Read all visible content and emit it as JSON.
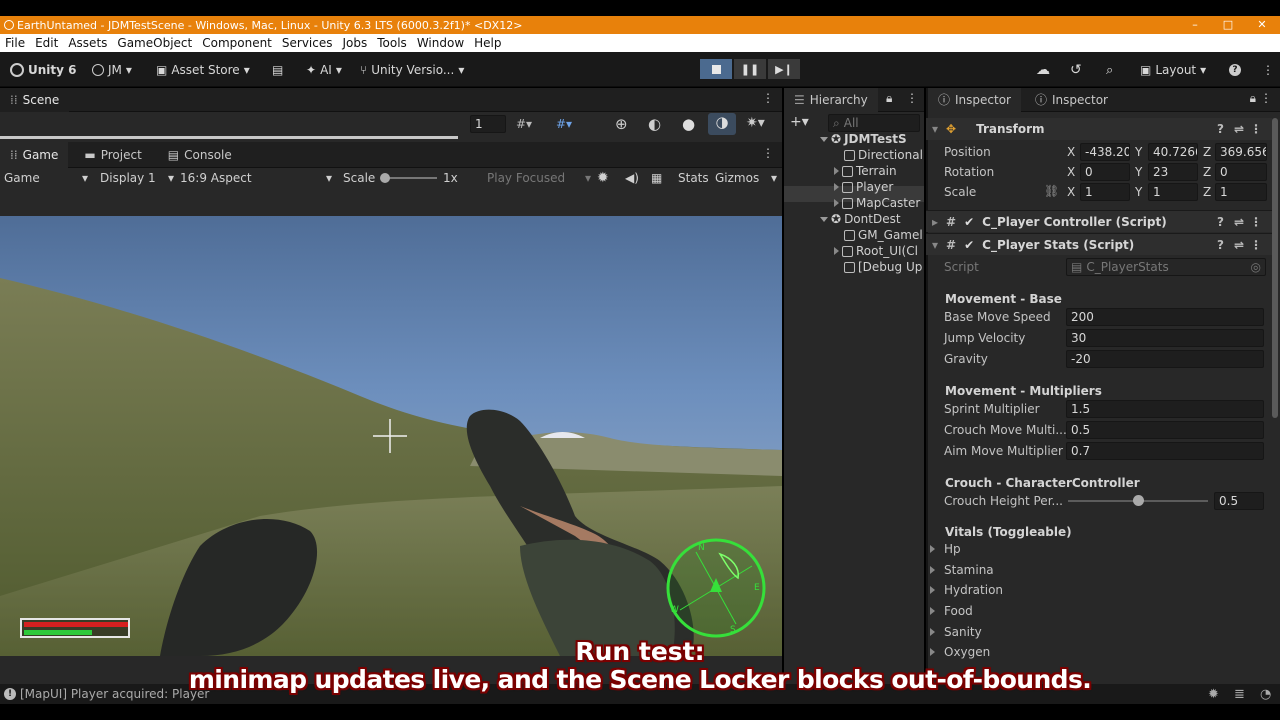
{
  "window": {
    "title": "EarthUntamed - JDMTestScene - Windows, Mac, Linux - Unity 6.3 LTS (6000.3.2f1)* <DX12>",
    "controls": [
      "–",
      "□",
      "✕"
    ]
  },
  "menu": [
    "File",
    "Edit",
    "Assets",
    "GameObject",
    "Component",
    "Services",
    "Jobs",
    "Tools",
    "Window",
    "Help"
  ],
  "toolbar": {
    "unity_label": "Unity 6",
    "account": "JM",
    "asset_store": "Asset Store",
    "ai": "AI",
    "version_control": "Unity Versio...",
    "layout": "Layout"
  },
  "scene": {
    "tab": "Scene",
    "field_value": "1"
  },
  "game": {
    "tabs": [
      "Game",
      "Project",
      "Console"
    ],
    "view_select": "Game",
    "display_select": "Display 1",
    "aspect_select": "16:9 Aspect",
    "scale_label": "Scale",
    "scale_value": "1x",
    "play_focused": "Play Focused",
    "stats": "Stats",
    "gizmos": "Gizmos",
    "hud": {
      "health_fraction": 1.0,
      "stamina_fraction": 0.65,
      "health_color": "#d62020",
      "stamina_color": "#2ec93a",
      "compass_letters": [
        "N",
        "E",
        "S",
        "W"
      ],
      "compass_color": "#36e03a"
    }
  },
  "hierarchy": {
    "tab": "Hierarchy",
    "search_placeholder": "All",
    "items": [
      {
        "label": "JDMTestS",
        "kind": "scene"
      },
      {
        "label": "Directional",
        "kind": "object"
      },
      {
        "label": "Terrain",
        "kind": "object"
      },
      {
        "label": "Player",
        "kind": "object",
        "selected": true
      },
      {
        "label": "MapCaster",
        "kind": "object"
      },
      {
        "label": "DontDest",
        "kind": "scene"
      },
      {
        "label": "GM_Gamel",
        "kind": "object"
      },
      {
        "label": "Root_UI(Cl",
        "kind": "object"
      },
      {
        "label": "[Debug Up",
        "kind": "object"
      }
    ]
  },
  "inspector": {
    "tabs": [
      "Inspector",
      "Inspector"
    ],
    "transform": {
      "title": "Transform",
      "position_label": "Position",
      "rotation_label": "Rotation",
      "scale_label": "Scale",
      "position": {
        "x": "-438.20",
        "y": "40.7266",
        "z": "369.656"
      },
      "rotation": {
        "x": "0",
        "y": "23",
        "z": "0"
      },
      "scale": {
        "x": "1",
        "y": "1",
        "z": "1"
      },
      "axis_labels": [
        "X",
        "Y",
        "Z"
      ]
    },
    "components": [
      "C_Player Controller (Script)",
      "C_Player Stats (Script)"
    ],
    "script_label": "Script",
    "script_value": "C_PlayerStats",
    "sections": {
      "movement_base": "Movement - Base",
      "movement_multipliers": "Movement - Multipliers",
      "crouch": "Crouch - CharacterController",
      "vitals": "Vitals (Toggleable)"
    },
    "fields": {
      "base_move_speed": {
        "label": "Base Move Speed",
        "value": "200"
      },
      "jump_velocity": {
        "label": "Jump Velocity",
        "value": "30"
      },
      "gravity": {
        "label": "Gravity",
        "value": "-20"
      },
      "sprint_multiplier": {
        "label": "Sprint Multiplier",
        "value": "1.5"
      },
      "crouch_move_multi": {
        "label": "Crouch Move Multi...",
        "value": "0.5"
      },
      "aim_move_multiplier": {
        "label": "Aim Move Multiplier",
        "value": "0.7"
      },
      "crouch_height": {
        "label": "Crouch Height Per...",
        "value": "0.5",
        "fraction": 0.5
      }
    },
    "vitals": [
      "Hp",
      "Stamina",
      "Hydration",
      "Food",
      "Sanity",
      "Oxygen"
    ]
  },
  "status": {
    "message": "[MapUI] Player acquired: Player"
  },
  "caption": {
    "line1": "Run test:",
    "line2": "minimap updates live, and the Scene Locker blocks out-of-bounds."
  }
}
